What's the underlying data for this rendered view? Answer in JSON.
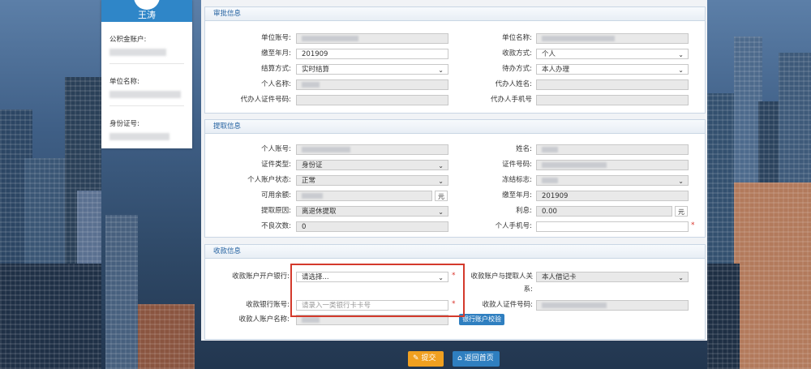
{
  "user": {
    "name": "王涛",
    "fields": [
      {
        "label": "公积金账户:"
      },
      {
        "label": "单位名称:"
      },
      {
        "label": "身份证号:"
      }
    ]
  },
  "sections": {
    "approval": "审批信息",
    "withdraw": "提取信息",
    "receive": "收款信息"
  },
  "approval": {
    "unit_account": "单位账号:",
    "unit_name": "单位名称:",
    "paid_until_label": "缴至年月:",
    "paid_until_value": "201909",
    "pay_method_label": "收款方式:",
    "pay_method_value": "个人",
    "settle_label": "结算方式:",
    "settle_value": "实时结算",
    "handle_label": "待办方式:",
    "handle_value": "本人办理",
    "person_name": "个人名称:",
    "agent_name": "代办人姓名:",
    "agent_id": "代办人证件号码:",
    "agent_phone": "代办人手机号"
  },
  "withdraw": {
    "person_account": "个人账号:",
    "name_label": "姓名:",
    "id_type_label": "证件类型:",
    "id_type_value": "身份证",
    "id_no_label": "证件号码:",
    "status_label": "个人账户状态:",
    "status_value": "正常",
    "freeze_label": "冻结标志:",
    "balance_label": "可用余额:",
    "unit_yuan": "元",
    "paid_until_label": "缴至年月:",
    "paid_until_value": "201909",
    "reason_label": "提取原因:",
    "reason_value": "离退休提取",
    "interest_label": "利息:",
    "interest_value": "0.00",
    "bad_label": "不良次数:",
    "bad_value": "0",
    "phone_label": "个人手机号:"
  },
  "receive": {
    "bank_label": "收款账户开户银行:",
    "bank_placeholder": "请选择...",
    "relation_label_1": "收款账户与提取人关",
    "relation_label_2": "系:",
    "relation_value": "本人借记卡",
    "bank_account_label": "收款银行账号:",
    "bank_account_placeholder": "请录入一类银行卡卡号",
    "receiver_id_label": "收款人证件号码:",
    "receiver_name_label": "收款人账户名称:",
    "verify_button": "银行账户校验"
  },
  "footer": {
    "submit": "提交",
    "home": "返回首页"
  }
}
